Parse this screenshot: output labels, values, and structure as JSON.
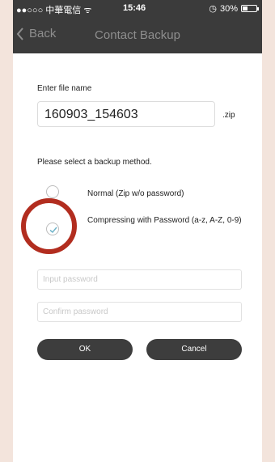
{
  "status_bar": {
    "carrier": "●●○○○ 中華電信 ᯤ",
    "time": "15:46",
    "battery_percent": "30%"
  },
  "nav": {
    "back_label": "Back",
    "title": "Contact Backup"
  },
  "form": {
    "file_name_label": "Enter file name",
    "file_name_value": "160903_154603",
    "file_extension": ".zip",
    "backup_method_label": "Please select a backup method.",
    "options": [
      {
        "label": "Normal (Zip w/o password)",
        "selected": false
      },
      {
        "label": "Compressing  with Password (a-z, A-Z, 0-9)",
        "selected": true
      }
    ],
    "password_placeholder": "Input password",
    "confirm_password_placeholder": "Confirm password"
  },
  "buttons": {
    "ok_label": "OK",
    "cancel_label": "Cancel"
  },
  "colors": {
    "bar_background": "#3b3b3b",
    "highlight": "#b22d1f",
    "check": "#6fb3c8",
    "button": "#3d3d3d"
  }
}
